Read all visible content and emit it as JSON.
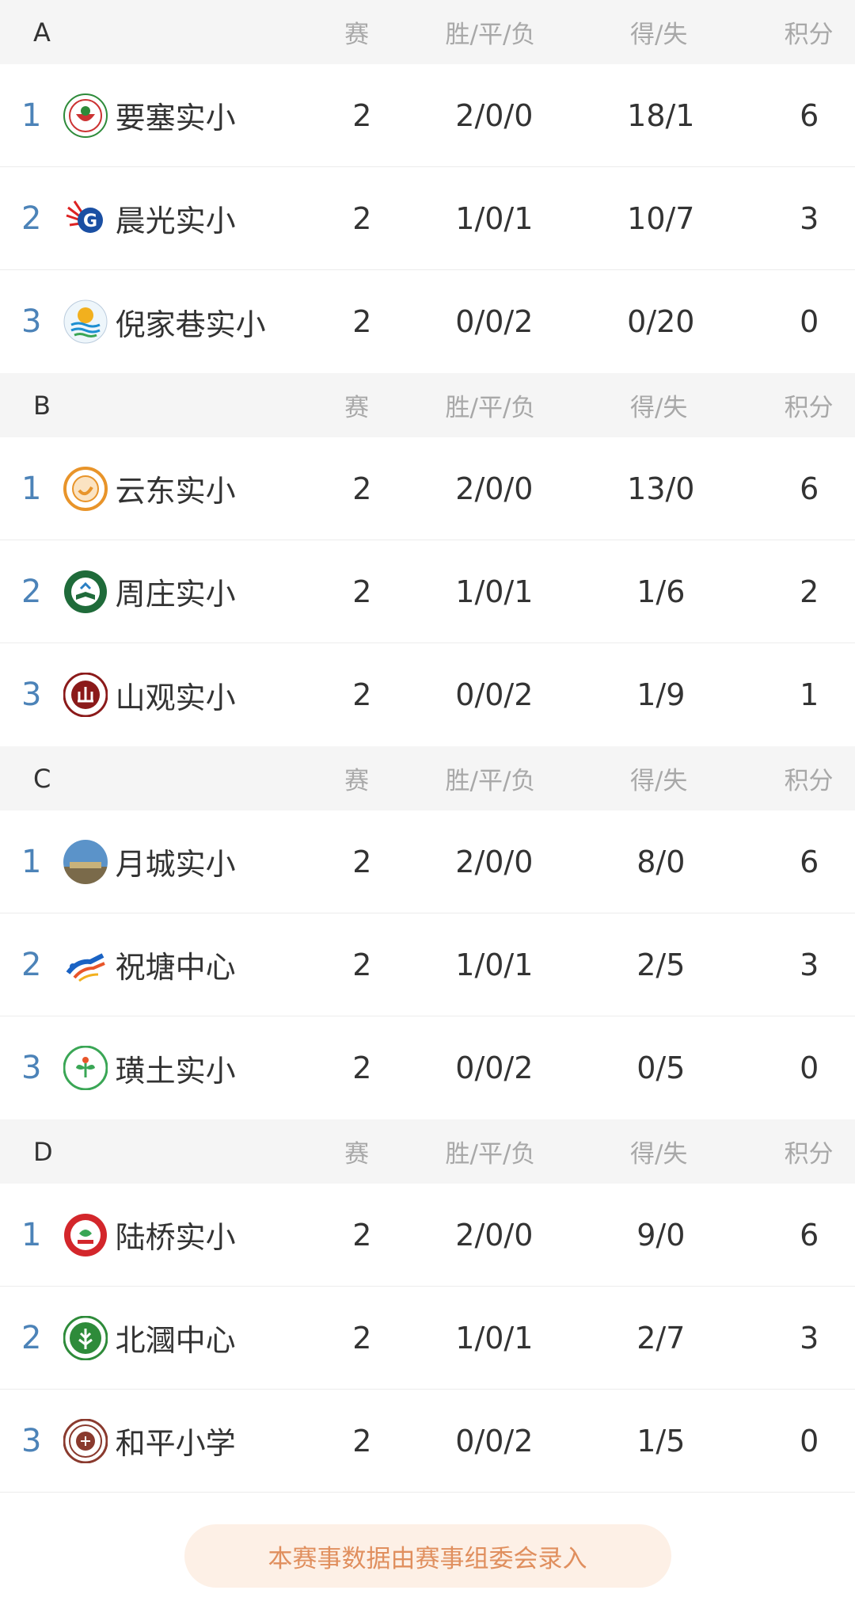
{
  "columns": {
    "games": "赛",
    "wdl": "胜/平/负",
    "gd": "得/失",
    "pts": "积分"
  },
  "colors": {
    "rank": "#4c83b8",
    "header_bg": "#f5f5f5",
    "footer_bg": "#fdf0e6",
    "footer_text": "#e08f5e"
  },
  "groups": [
    {
      "name": "A",
      "teams": [
        {
          "rank": "1",
          "logo": "school-emblem-red-green",
          "name": "要塞实小",
          "games": "2",
          "wdl": "2/0/0",
          "gd": "18/1",
          "pts": "6"
        },
        {
          "rank": "2",
          "logo": "school-emblem-blue-red-g",
          "name": "晨光实小",
          "games": "2",
          "wdl": "1/0/1",
          "gd": "10/7",
          "pts": "3"
        },
        {
          "rank": "3",
          "logo": "school-emblem-sun-waves",
          "name": "倪家巷实小",
          "games": "2",
          "wdl": "0/0/2",
          "gd": "0/20",
          "pts": "0"
        }
      ]
    },
    {
      "name": "B",
      "teams": [
        {
          "rank": "1",
          "logo": "school-emblem-orange-ring",
          "name": "云东实小",
          "games": "2",
          "wdl": "2/0/0",
          "gd": "13/0",
          "pts": "6"
        },
        {
          "rank": "2",
          "logo": "school-emblem-green-book",
          "name": "周庄实小",
          "games": "2",
          "wdl": "1/0/1",
          "gd": "1/6",
          "pts": "2"
        },
        {
          "rank": "3",
          "logo": "school-emblem-maroon",
          "name": "山观实小",
          "games": "2",
          "wdl": "0/0/2",
          "gd": "1/9",
          "pts": "1"
        }
      ]
    },
    {
      "name": "C",
      "teams": [
        {
          "rank": "1",
          "logo": "school-photo-sky",
          "name": "月城实小",
          "games": "2",
          "wdl": "2/0/0",
          "gd": "8/0",
          "pts": "6"
        },
        {
          "rank": "2",
          "logo": "school-emblem-blue-runner",
          "name": "祝塘中心",
          "games": "2",
          "wdl": "1/0/1",
          "gd": "2/5",
          "pts": "3"
        },
        {
          "rank": "3",
          "logo": "school-emblem-green-plant",
          "name": "璜土实小",
          "games": "2",
          "wdl": "0/0/2",
          "gd": "0/5",
          "pts": "0"
        }
      ]
    },
    {
      "name": "D",
      "teams": [
        {
          "rank": "1",
          "logo": "school-emblem-red-round",
          "name": "陆桥实小",
          "games": "2",
          "wdl": "2/0/0",
          "gd": "9/0",
          "pts": "6"
        },
        {
          "rank": "2",
          "logo": "school-emblem-green-tree",
          "name": "北漍中心",
          "games": "2",
          "wdl": "1/0/1",
          "gd": "2/7",
          "pts": "3"
        },
        {
          "rank": "3",
          "logo": "school-emblem-brown-seal",
          "name": "和平小学",
          "games": "2",
          "wdl": "0/0/2",
          "gd": "1/5",
          "pts": "0"
        }
      ]
    }
  ],
  "footer": {
    "text": "本赛事数据由赛事组委会录入"
  }
}
